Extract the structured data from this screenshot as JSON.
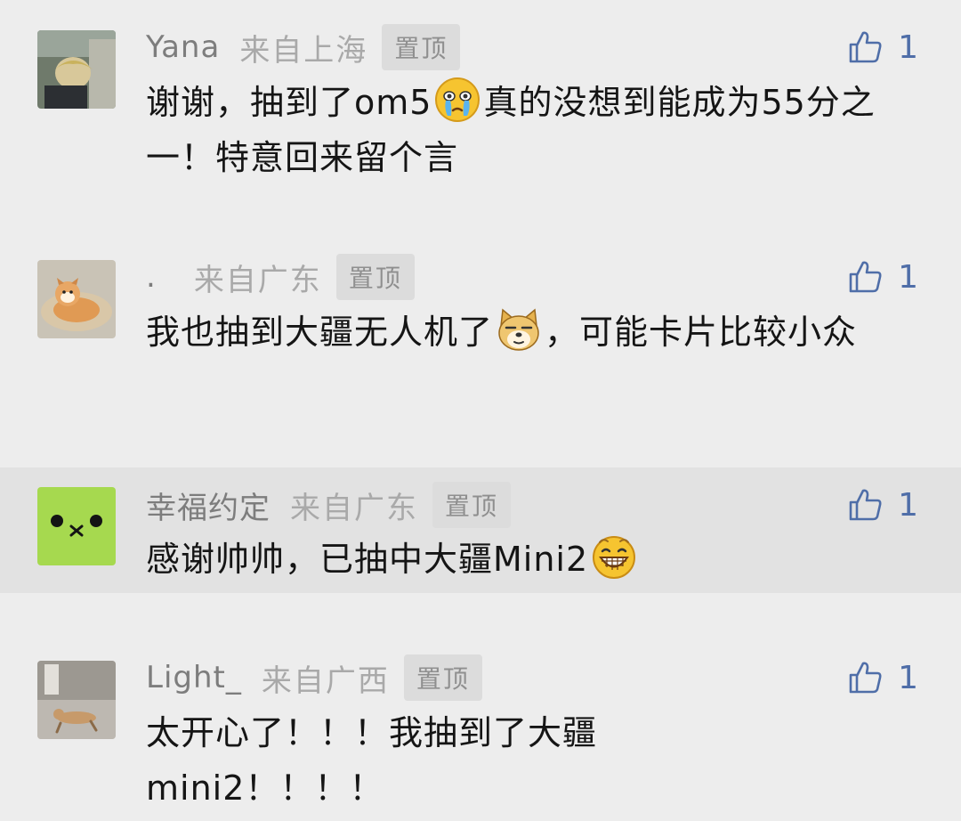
{
  "comments": [
    {
      "nickname": "Yana",
      "location": "来自上海",
      "pinned_label": "置顶",
      "likes": "1",
      "text_before": "谢谢，抽到了om5",
      "emoji": "crying-face-icon",
      "text_after": "真的没想到能成为55分之一！特意回来留个言"
    },
    {
      "nickname": ".",
      "location": "来自广东",
      "pinned_label": "置顶",
      "likes": "1",
      "text_before": "我也抽到大疆无人机了",
      "emoji": "doge-icon",
      "text_after": "，可能卡片比较小众"
    },
    {
      "nickname": "幸福约定",
      "location": "来自广东",
      "pinned_label": "置顶",
      "likes": "1",
      "text_before": "感谢帅帅，已抽中大疆Mini2",
      "emoji": "grin-face-icon",
      "text_after": ""
    },
    {
      "nickname": "Light_",
      "location": "来自广西",
      "pinned_label": "置顶",
      "likes": "1",
      "text_before": "太开心了！！！我抽到了大疆",
      "text_line2": "mini2！！！！"
    }
  ],
  "colors": {
    "background": "#ededed",
    "highlight_row": "#e2e2e2",
    "like_accent": "#4f6ea8",
    "nickname": "#7d7d7d",
    "location": "#a9a9a9"
  }
}
